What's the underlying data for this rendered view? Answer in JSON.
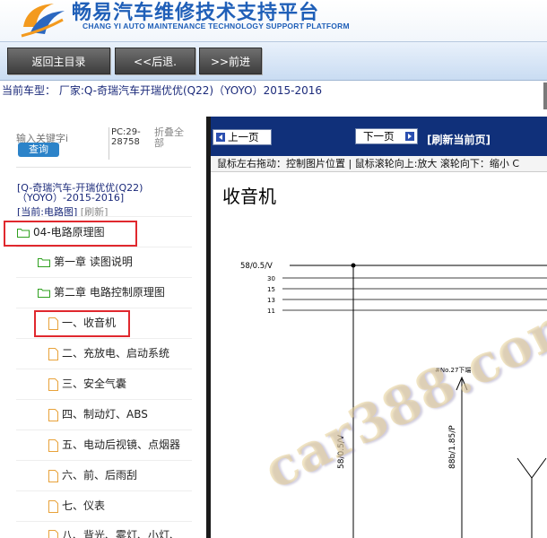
{
  "header": {
    "title_cn": "畅易汽车维修技术支持平台",
    "title_en": "CHANG YI AUTO MAINTENANCE TECHNOLOGY SUPPORT PLATFORM",
    "logo_icon": "changyi-logo-icon",
    "colors": {
      "brand": "#1f5fb8",
      "logo_orange": "#f39a1e"
    }
  },
  "toolbar": {
    "home_label": "返回主目录",
    "back_label": "<<后退.",
    "forward_label": ">>前进"
  },
  "car_info": {
    "text": "当前车型： 厂家:Q-奇瑞汽车开瑞优优(Q22)（YOYO）2015-2016"
  },
  "sidebar": {
    "search_placeholder": "输入关键字i",
    "search_button": "查询",
    "pc_info": "PC:29-28758",
    "fold_all": "折叠全部",
    "car_title": "[Q-奇瑞汽车-开瑞优优(Q22)（YOYO）-2015-2016]",
    "current_prefix": "[当前:",
    "current_value": "电路图]",
    "refresh": "[刷新]",
    "tree": [
      {
        "label": "04-电路原理图",
        "icon": "folder-icon",
        "level": 0
      },
      {
        "label": "第一章 读图说明",
        "icon": "folder-icon",
        "level": 1
      },
      {
        "label": "第二章 电路控制原理图",
        "icon": "folder-icon",
        "level": 1
      },
      {
        "label": "一、收音机",
        "icon": "document-icon",
        "level": 2
      },
      {
        "label": "二、充放电、启动系统",
        "icon": "document-icon",
        "level": 2
      },
      {
        "label": "三、安全气囊",
        "icon": "document-icon",
        "level": 2
      },
      {
        "label": "四、制动灯、ABS",
        "icon": "document-icon",
        "level": 2
      },
      {
        "label": "五、电动后视镜、点烟器",
        "icon": "document-icon",
        "level": 2
      },
      {
        "label": "六、前、后雨刮",
        "icon": "document-icon",
        "level": 2
      },
      {
        "label": "七、仪表",
        "icon": "document-icon",
        "level": 2
      },
      {
        "label": "八、背光、雾灯、小灯、",
        "icon": "document-icon",
        "level": 2
      }
    ]
  },
  "viewer": {
    "prev_label": "上一页",
    "next_label": "下一页",
    "refresh_label": "[刷新当前页]",
    "hint": "鼠标左右拖动：控制图片位置 | 鼠标滚轮向上:放大  滚轮向下：缩小  C",
    "diagram_title": "收音机",
    "watermark": "car388.com",
    "bus_labels": [
      "58/0.5/V",
      "30",
      "15",
      "13",
      "11"
    ],
    "wire_label_1": "58/0.5/V",
    "wire_label_2": "88b/1.85/P",
    "connector_label": "#No.27下端",
    "colors": {
      "nav_bg": "#10307a",
      "highlight": "#e0282e"
    }
  }
}
